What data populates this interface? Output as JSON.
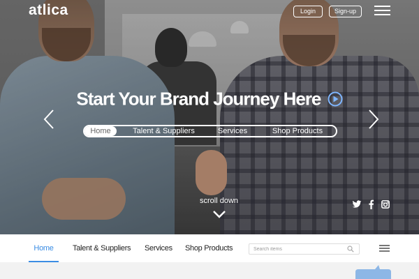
{
  "brand": {
    "logo_text": "atlica"
  },
  "header": {
    "login_label": "Login",
    "signup_label": "Sign-up"
  },
  "hero": {
    "title": "Start Your Brand Journey Here",
    "scroll_label": "scroll down",
    "tabs": [
      {
        "label": "Home",
        "active": true
      },
      {
        "label": "Talent & Suppliers",
        "active": false
      },
      {
        "label": "Services",
        "active": false
      },
      {
        "label": "Shop Products",
        "active": false
      }
    ],
    "accent_color": "#3b8de4"
  },
  "social": {
    "icons": [
      "twitter-icon",
      "facebook-icon",
      "instagram-icon"
    ]
  },
  "nav": {
    "items": [
      {
        "label": "Home",
        "active": true
      },
      {
        "label": "Talent & Suppliers",
        "active": false
      },
      {
        "label": "Services",
        "active": false
      },
      {
        "label": "Shop Products",
        "active": false
      }
    ],
    "search_placeholder": "Search items",
    "active_color": "#3b8de4"
  }
}
